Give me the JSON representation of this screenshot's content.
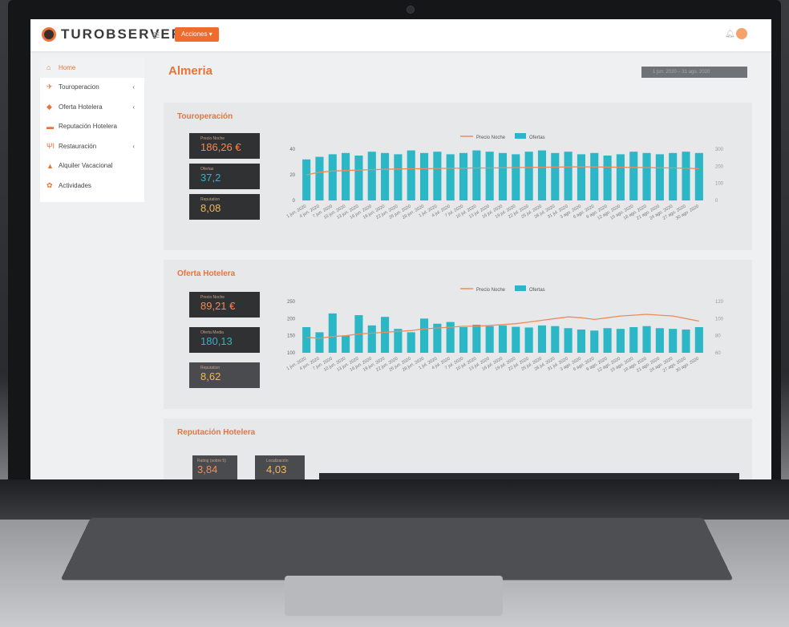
{
  "app": {
    "logo_text": "TUROBSERVER",
    "actions_label": "Acciones ▾",
    "menu_icon": "hamburger-icon"
  },
  "colors": {
    "accent": "#e8743b",
    "teal": "#2bb7c6",
    "line": "#f08a5d",
    "panel": "#e7e8ea"
  },
  "sidebar": {
    "items": [
      {
        "label": "Home",
        "icon": "home-icon",
        "active": true
      },
      {
        "label": "Touroperacion",
        "icon": "plane-icon",
        "chevron": "‹"
      },
      {
        "label": "Oferta Hotelera",
        "icon": "tag-icon",
        "chevron": "‹"
      },
      {
        "label": "Reputación Hotelera",
        "icon": "star-icon"
      },
      {
        "label": "Restauración",
        "icon": "cutlery-icon",
        "chevron": "‹"
      },
      {
        "label": "Alquiler Vacacional",
        "icon": "house-icon"
      },
      {
        "label": "Actividades",
        "icon": "activity-icon"
      }
    ]
  },
  "page": {
    "title": "Almeria",
    "date_range": "1 jun. 2020 – 31 ago. 2020"
  },
  "panels": {
    "touroperacion": {
      "title": "Touroperación",
      "kpis": [
        {
          "label": "Precio Noche",
          "value": "186,26 €"
        },
        {
          "label": "Ofertas",
          "value": "37,2"
        },
        {
          "label": "Reputation",
          "value": "8,08"
        }
      ]
    },
    "oferta": {
      "title": "Oferta Hotelera",
      "kpis": [
        {
          "label": "Precio Noche",
          "value": "89,21 €"
        },
        {
          "label": "Oferta Media",
          "value": "180,13"
        },
        {
          "label": "Reputation",
          "value": "8,62"
        }
      ]
    },
    "reputacion": {
      "title": "Reputación Hotelera",
      "kpis": [
        {
          "label": "Rating (sobre 5)",
          "value": "3,84"
        },
        {
          "label": "Localización",
          "value": "4,03"
        }
      ]
    }
  },
  "chart_data": [
    {
      "type": "bar",
      "legend": [
        "Precio Noche",
        "Ofertas"
      ],
      "left_ticks": [
        "40",
        "20",
        "0"
      ],
      "right_ticks": [
        "300",
        "200",
        "100",
        "0"
      ],
      "categories": [
        "1 jun. 2020",
        "4 jun. 2020",
        "7 jun. 2020",
        "10 jun. 2020",
        "13 jun. 2020",
        "16 jun. 2020",
        "19 jun. 2020",
        "22 jun. 2020",
        "25 jun. 2020",
        "28 jun. 2020",
        "1 jul. 2020",
        "4 jul. 2020",
        "7 jul. 2020",
        "10 jul. 2020",
        "13 jul. 2020",
        "16 jul. 2020",
        "19 jul. 2020",
        "22 jul. 2020",
        "25 jul. 2020",
        "28 jul. 2020",
        "31 jul. 2020",
        "3 ago. 2020",
        "6 ago. 2020",
        "9 ago. 2020",
        "12 ago. 2020",
        "15 ago. 2020",
        "18 ago. 2020",
        "21 ago. 2020",
        "24 ago. 2020",
        "27 ago. 2020",
        "30 ago. 2020"
      ],
      "series": [
        {
          "name": "Ofertas",
          "values": [
            32,
            34,
            36,
            37,
            35,
            38,
            37,
            36,
            39,
            37,
            38,
            36,
            37,
            39,
            38,
            37,
            36,
            38,
            39,
            37,
            38,
            36,
            37,
            35,
            36,
            38,
            37,
            36,
            37,
            38,
            37
          ]
        },
        {
          "name": "Precio Noche",
          "values": [
            150,
            165,
            172,
            175,
            178,
            180,
            182,
            184,
            185,
            186,
            187,
            188,
            189,
            190,
            190,
            191,
            192,
            193,
            194,
            195,
            196,
            197,
            196,
            195,
            194,
            193,
            192,
            191,
            190,
            188,
            186
          ]
        }
      ]
    },
    {
      "type": "bar",
      "legend": [
        "Precio Noche",
        "Ofertas"
      ],
      "left_ticks": [
        "250",
        "200",
        "150",
        "100"
      ],
      "right_ticks": [
        "120",
        "100",
        "80",
        "60"
      ],
      "categories": [
        "1 jun. 2020",
        "4 jun. 2020",
        "7 jun. 2020",
        "10 jun. 2020",
        "13 jun. 2020",
        "16 jun. 2020",
        "19 jun. 2020",
        "22 jun. 2020",
        "25 jun. 2020",
        "28 jun. 2020",
        "1 jul. 2020",
        "4 jul. 2020",
        "7 jul. 2020",
        "10 jul. 2020",
        "13 jul. 2020",
        "16 jul. 2020",
        "19 jul. 2020",
        "22 jul. 2020",
        "25 jul. 2020",
        "28 jul. 2020",
        "31 jul. 2020",
        "3 ago. 2020",
        "6 ago. 2020",
        "9 ago. 2020",
        "12 ago. 2020",
        "15 ago. 2020",
        "18 ago. 2020",
        "21 ago. 2020",
        "24 ago. 2020",
        "27 ago. 2020",
        "30 ago. 2020"
      ],
      "series": [
        {
          "name": "Ofertas",
          "values": [
            175,
            160,
            215,
            150,
            210,
            180,
            205,
            170,
            160,
            200,
            185,
            190,
            175,
            182,
            178,
            180,
            176,
            174,
            180,
            178,
            172,
            168,
            165,
            172,
            170,
            175,
            178,
            172,
            170,
            168,
            175
          ]
        },
        {
          "name": "Precio Noche",
          "values": [
            78,
            77,
            79,
            80,
            82,
            83,
            84,
            85,
            86,
            88,
            89,
            90,
            91,
            91,
            92,
            93,
            94,
            96,
            98,
            100,
            102,
            101,
            99,
            101,
            103,
            104,
            105,
            104,
            103,
            100,
            97
          ]
        }
      ]
    }
  ]
}
